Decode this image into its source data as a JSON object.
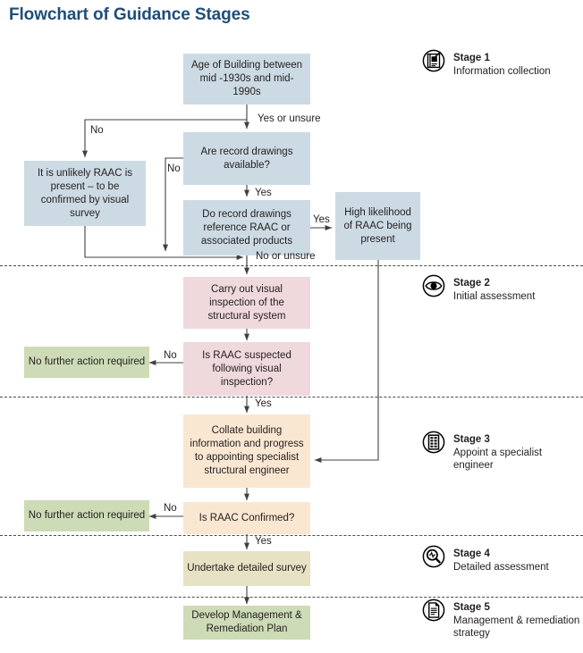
{
  "title": "Flowchart of Guidance Stages",
  "colors": {
    "title": "#1F4E79",
    "stage1_fill": "#ccdae3",
    "stage2_fill": "#efd9dd",
    "stage3_fill": "#fae7d2",
    "stage4_fill": "#e6e2c3",
    "stage5_fill": "#cddbb6",
    "outcome_fill": "#cddbb6",
    "connector": "#404040",
    "divider": "#4a4a4a"
  },
  "nodes": {
    "age_of_building": "Age of Building between mid -1930s and mid-1990s",
    "unlikely_raac": "It is unlikely RAAC is present – to be confirmed by visual survey",
    "record_drawings_available": "Are record drawings available?",
    "drawings_reference_raac": "Do record drawings reference RAAC or associated products",
    "high_likelihood": "High likelihood of RAAC being present",
    "visual_inspection": "Carry out visual inspection of the structural system",
    "raac_suspected": "Is RAAC suspected following visual inspection?",
    "no_further_action_1": "No further action required",
    "collate_building_info": "Collate building information and progress to appointing specialist structural engineer",
    "raac_confirmed": "Is RAAC Confirmed?",
    "no_further_action_2": "No further action required",
    "detailed_survey": "Undertake detailed survey",
    "management_plan": "Develop Management & Remediation Plan"
  },
  "edge_labels": {
    "yes_or_unsure": "Yes or unsure",
    "no_age": "No",
    "no_drawings": "No",
    "yes_drawings": "Yes",
    "yes_reference": "Yes",
    "no_or_unsure": "No or unsure",
    "no_suspected": "No",
    "yes_suspected": "Yes",
    "no_confirmed": "No",
    "yes_confirmed": "Yes"
  },
  "stages": [
    {
      "id": "stage-1",
      "icon": "form-document-icon",
      "title": "Stage 1",
      "subtitle": "Information collection"
    },
    {
      "id": "stage-2",
      "icon": "eye-icon",
      "title": "Stage 2",
      "subtitle": "Initial assessment"
    },
    {
      "id": "stage-3",
      "icon": "building-icon",
      "title": "Stage 3",
      "subtitle": "Appoint a specialist engineer"
    },
    {
      "id": "stage-4",
      "icon": "magnifier-icon",
      "title": "Stage 4",
      "subtitle": "Detailed assessment"
    },
    {
      "id": "stage-5",
      "icon": "document-icon",
      "title": "Stage 5",
      "subtitle": "Management & remediation strategy"
    }
  ],
  "chart_data": {
    "type": "diagram",
    "title": "Flowchart of Guidance Stages",
    "nodes": [
      {
        "id": "age_of_building",
        "label": "Age of Building between mid -1930s and mid-1990s",
        "stage": 1,
        "fill": "#ccdae3"
      },
      {
        "id": "unlikely_raac",
        "label": "It is unlikely RAAC is present – to be confirmed by visual survey",
        "stage": 1,
        "fill": "#ccdae3"
      },
      {
        "id": "record_drawings_available",
        "label": "Are record drawings available?",
        "stage": 1,
        "fill": "#ccdae3"
      },
      {
        "id": "drawings_reference_raac",
        "label": "Do record drawings reference RAAC or associated products",
        "stage": 1,
        "fill": "#ccdae3"
      },
      {
        "id": "high_likelihood",
        "label": "High likelihood of RAAC being present",
        "stage": 1,
        "fill": "#ccdae3"
      },
      {
        "id": "visual_inspection",
        "label": "Carry out visual inspection of the structural system",
        "stage": 2,
        "fill": "#efd9dd"
      },
      {
        "id": "raac_suspected",
        "label": "Is RAAC suspected following visual inspection?",
        "stage": 2,
        "fill": "#efd9dd"
      },
      {
        "id": "no_further_action_1",
        "label": "No further action required",
        "stage": 2,
        "fill": "#cddbb6"
      },
      {
        "id": "collate_building_info",
        "label": "Collate building information and progress to appointing specialist structural engineer",
        "stage": 3,
        "fill": "#fae7d2"
      },
      {
        "id": "raac_confirmed",
        "label": "Is RAAC Confirmed?",
        "stage": 3,
        "fill": "#fae7d2"
      },
      {
        "id": "no_further_action_2",
        "label": "No further action required",
        "stage": 3,
        "fill": "#cddbb6"
      },
      {
        "id": "detailed_survey",
        "label": "Undertake detailed survey",
        "stage": 4,
        "fill": "#e6e2c3"
      },
      {
        "id": "management_plan",
        "label": "Develop Management & Remediation Plan",
        "stage": 5,
        "fill": "#cddbb6"
      }
    ],
    "edges": [
      {
        "from": "age_of_building",
        "to": "record_drawings_available",
        "label": "Yes or unsure"
      },
      {
        "from": "age_of_building",
        "to": "unlikely_raac",
        "label": "No"
      },
      {
        "from": "record_drawings_available",
        "to": "drawings_reference_raac",
        "label": "Yes"
      },
      {
        "from": "record_drawings_available",
        "to": "visual_inspection",
        "label": "No"
      },
      {
        "from": "drawings_reference_raac",
        "to": "high_likelihood",
        "label": "Yes"
      },
      {
        "from": "drawings_reference_raac",
        "to": "visual_inspection",
        "label": "No or unsure"
      },
      {
        "from": "unlikely_raac",
        "to": "visual_inspection",
        "label": ""
      },
      {
        "from": "high_likelihood",
        "to": "collate_building_info",
        "label": ""
      },
      {
        "from": "visual_inspection",
        "to": "raac_suspected",
        "label": ""
      },
      {
        "from": "raac_suspected",
        "to": "no_further_action_1",
        "label": "No"
      },
      {
        "from": "raac_suspected",
        "to": "collate_building_info",
        "label": "Yes"
      },
      {
        "from": "collate_building_info",
        "to": "raac_confirmed",
        "label": ""
      },
      {
        "from": "raac_confirmed",
        "to": "no_further_action_2",
        "label": "No"
      },
      {
        "from": "raac_confirmed",
        "to": "detailed_survey",
        "label": "Yes"
      },
      {
        "from": "detailed_survey",
        "to": "management_plan",
        "label": ""
      }
    ],
    "stage_bands": [
      {
        "stage": 1,
        "title": "Stage 1",
        "subtitle": "Information collection"
      },
      {
        "stage": 2,
        "title": "Stage 2",
        "subtitle": "Initial assessment"
      },
      {
        "stage": 3,
        "title": "Stage 3",
        "subtitle": "Appoint a specialist engineer"
      },
      {
        "stage": 4,
        "title": "Stage 4",
        "subtitle": "Detailed assessment"
      },
      {
        "stage": 5,
        "title": "Stage 5",
        "subtitle": "Management & remediation strategy"
      }
    ]
  }
}
